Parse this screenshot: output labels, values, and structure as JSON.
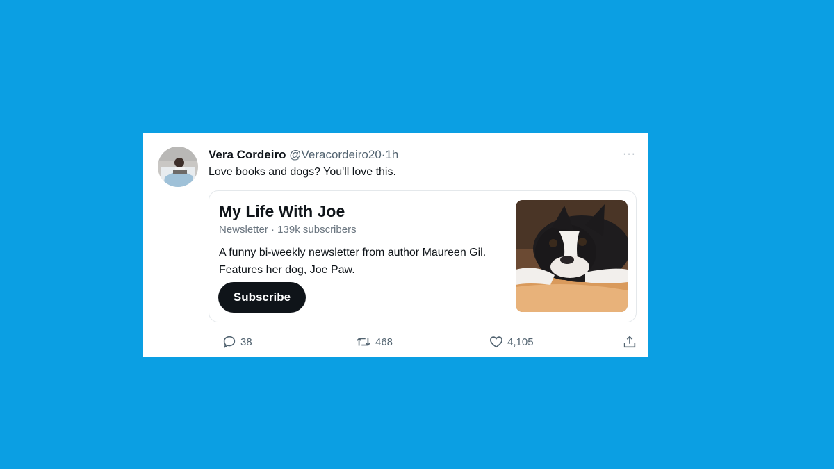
{
  "tweet": {
    "author": {
      "display_name": "Vera Cordeiro",
      "handle": "@Veracordeiro20",
      "separator": "·",
      "time": "1h"
    },
    "more_label": "···",
    "text": "Love books and dogs? You'll love this.",
    "newsletter": {
      "title": "My Life With Joe",
      "meta": "Newsletter · 139k subscribers",
      "description": "A funny bi-weekly newsletter from author Maureen Gil. Features her dog, Joe Paw.",
      "subscribe_label": "Subscribe"
    },
    "actions": {
      "replies": "38",
      "retweets": "468",
      "likes": "4,105"
    }
  },
  "colors": {
    "background": "#0b9fe3",
    "card": "#ffffff",
    "text_primary": "#0f1419",
    "text_secondary": "#536471",
    "button": "#0f1419"
  },
  "icons": [
    "reply-icon",
    "retweet-icon",
    "like-icon",
    "share-icon",
    "more-icon"
  ]
}
